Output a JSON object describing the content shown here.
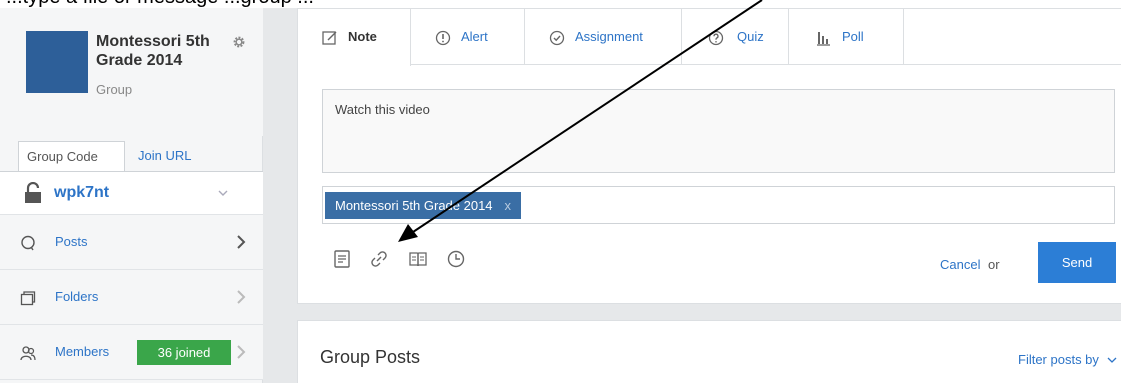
{
  "top_strip": {
    "text": "...type a file or message ...group ..."
  },
  "group": {
    "name": "Montessori 5th Grade 2014",
    "type": "Group",
    "avatar_color": "#2d5f99"
  },
  "code_tabs": {
    "active": "Group Code",
    "other": "Join URL"
  },
  "group_code": {
    "value": "wpk7nt"
  },
  "nav": {
    "posts": "Posts",
    "folders": "Folders",
    "members": "Members",
    "members_badge": "36 joined"
  },
  "composer": {
    "tabs": [
      {
        "label": "Note",
        "icon": "note-icon"
      },
      {
        "label": "Alert",
        "icon": "alert-icon"
      },
      {
        "label": "Assignment",
        "icon": "assignment-icon"
      },
      {
        "label": "Quiz",
        "icon": "quiz-icon"
      },
      {
        "label": "Poll",
        "icon": "poll-icon"
      }
    ],
    "message": "Watch this video",
    "recipient_chip": "Montessori 5th Grade 2014",
    "chip_remove": "x",
    "cancel_label": "Cancel",
    "or_label": "or",
    "send_label": "Send"
  },
  "posts": {
    "title": "Group Posts",
    "filter_label": "Filter posts by"
  },
  "colors": {
    "accent": "#2d74c7",
    "send": "#2c7ed6",
    "badge": "#3aa64a",
    "chip": "#3a6ea5"
  }
}
